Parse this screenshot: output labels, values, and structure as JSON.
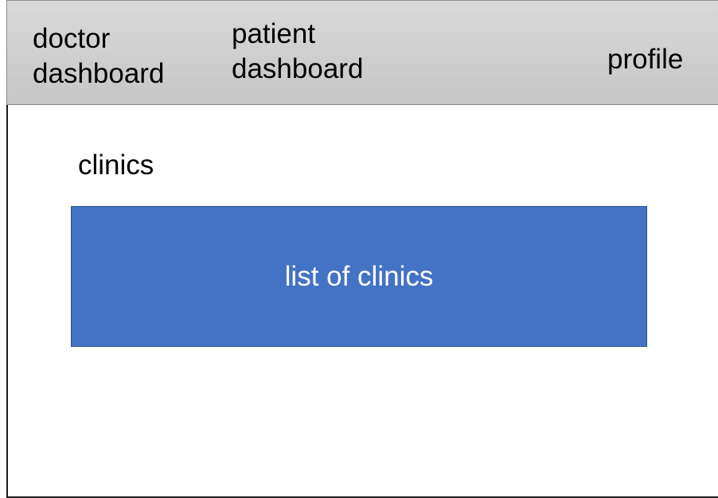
{
  "navbar": {
    "doctor_dashboard": "doctor\ndashboard",
    "patient_dashboard": "patient\ndashboard",
    "profile": "profile"
  },
  "main": {
    "section_title": "clinics",
    "clinic_list_label": "list of clinics"
  },
  "colors": {
    "navbar_bg": "#d0d0d0",
    "clinic_list_bg": "#4472c4",
    "clinic_list_border": "#2f528f",
    "clinic_list_text": "#ffffff"
  }
}
